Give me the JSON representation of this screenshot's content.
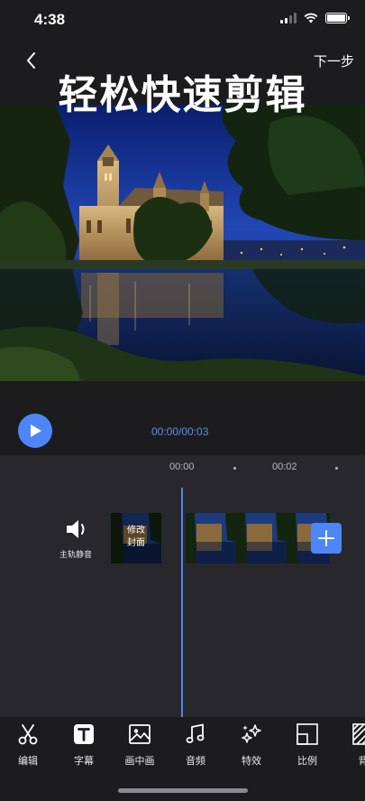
{
  "status_bar": {
    "time": "4:38"
  },
  "nav": {
    "back_icon": "chevron-left-icon",
    "next_label": "下一步"
  },
  "headline": "轻松快速剪辑",
  "player": {
    "play_icon": "play-icon",
    "time": "00:00/00:03"
  },
  "timeline": {
    "ruler": [
      "00:00",
      "00:02"
    ],
    "mute_label": "主轨静音",
    "cover_label_line1": "修改",
    "cover_label_line2": "封面",
    "add_icon": "plus-icon"
  },
  "toolbar": {
    "items": [
      {
        "label": "编辑",
        "icon": "scissors-icon"
      },
      {
        "label": "字幕",
        "icon": "text-icon"
      },
      {
        "label": "画中画",
        "icon": "image-icon"
      },
      {
        "label": "音频",
        "icon": "music-note-icon"
      },
      {
        "label": "特效",
        "icon": "sparkle-icon"
      },
      {
        "label": "比例",
        "icon": "aspect-ratio-icon"
      },
      {
        "label": "背",
        "icon": "background-pattern-icon"
      }
    ]
  },
  "colors": {
    "accent": "#4f86f7",
    "background": "#1c1c1f",
    "timeline_bg": "#28282c"
  }
}
